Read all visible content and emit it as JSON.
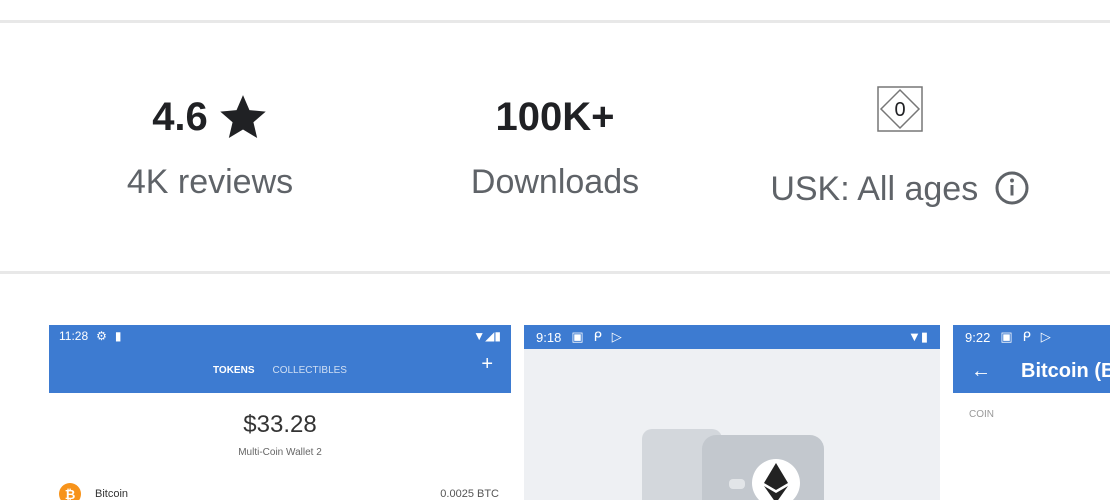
{
  "stats": {
    "rating": {
      "value": "4.6",
      "label": "4K reviews"
    },
    "downloads": {
      "value": "100K+",
      "label": "Downloads"
    },
    "content_rating": {
      "badge": "0",
      "label": "USK: All ages"
    }
  },
  "screenshots": [
    {
      "status_time": "11:28",
      "tabs": [
        "TOKENS",
        "COLLECTIBLES"
      ],
      "add_label": "+",
      "balance": "$33.28",
      "wallet_name": "Multi-Coin Wallet 2",
      "coin_name": "Bitcoin",
      "coin_amount": "0.0025 BTC"
    },
    {
      "status_time": "9:18"
    },
    {
      "status_time": "9:22",
      "back_label": "←",
      "title": "Bitcoin (B",
      "caption": "COIN"
    }
  ],
  "colors": {
    "app_blue": "#3d7bd1",
    "bitcoin_orange": "#f7931a"
  }
}
